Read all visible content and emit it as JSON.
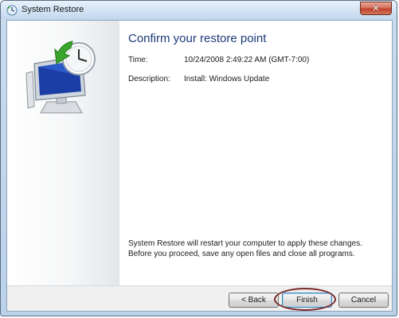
{
  "window": {
    "title": "System Restore",
    "close_glyph": "✕"
  },
  "main": {
    "heading": "Confirm your restore point",
    "time_label": "Time:",
    "time_value": "10/24/2008 2:49:22 AM (GMT-7:00)",
    "description_label": "Description:",
    "description_value": "Install: Windows Update",
    "notice": "System Restore will restart your computer to apply these changes. Before you proceed, save any open files and close all programs."
  },
  "buttons": {
    "back": "< Back",
    "finish": "Finish",
    "cancel": "Cancel"
  },
  "colors": {
    "heading": "#1c3a7a",
    "highlight_ring": "#7a2a2a",
    "clock_arrow": "#3aa52b"
  },
  "icons": {
    "title": "system-restore-icon",
    "illustration": "monitor-clock-restore-icon"
  }
}
